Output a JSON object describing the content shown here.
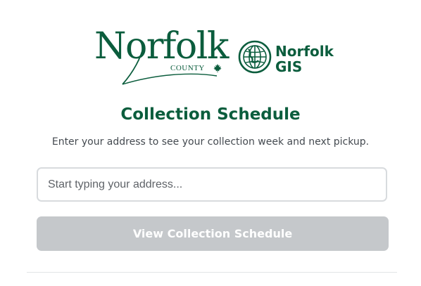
{
  "logos": {
    "county_wordmark": "Norfolk",
    "county_subword": "COUNTY",
    "gis_line1": "Norfolk",
    "gis_line2": "GIS",
    "brand_color": "#0b5d3d",
    "maple_leaf_icon": "maple-leaf-icon",
    "globe_icon": "globe-icon"
  },
  "main": {
    "title": "Collection Schedule",
    "subtitle": "Enter your address to see your collection week and next pickup.",
    "address_placeholder": "Start typing your address...",
    "address_value": "",
    "view_button_label": "View Collection Schedule",
    "button_disabled_color": "#c5c8cb"
  }
}
